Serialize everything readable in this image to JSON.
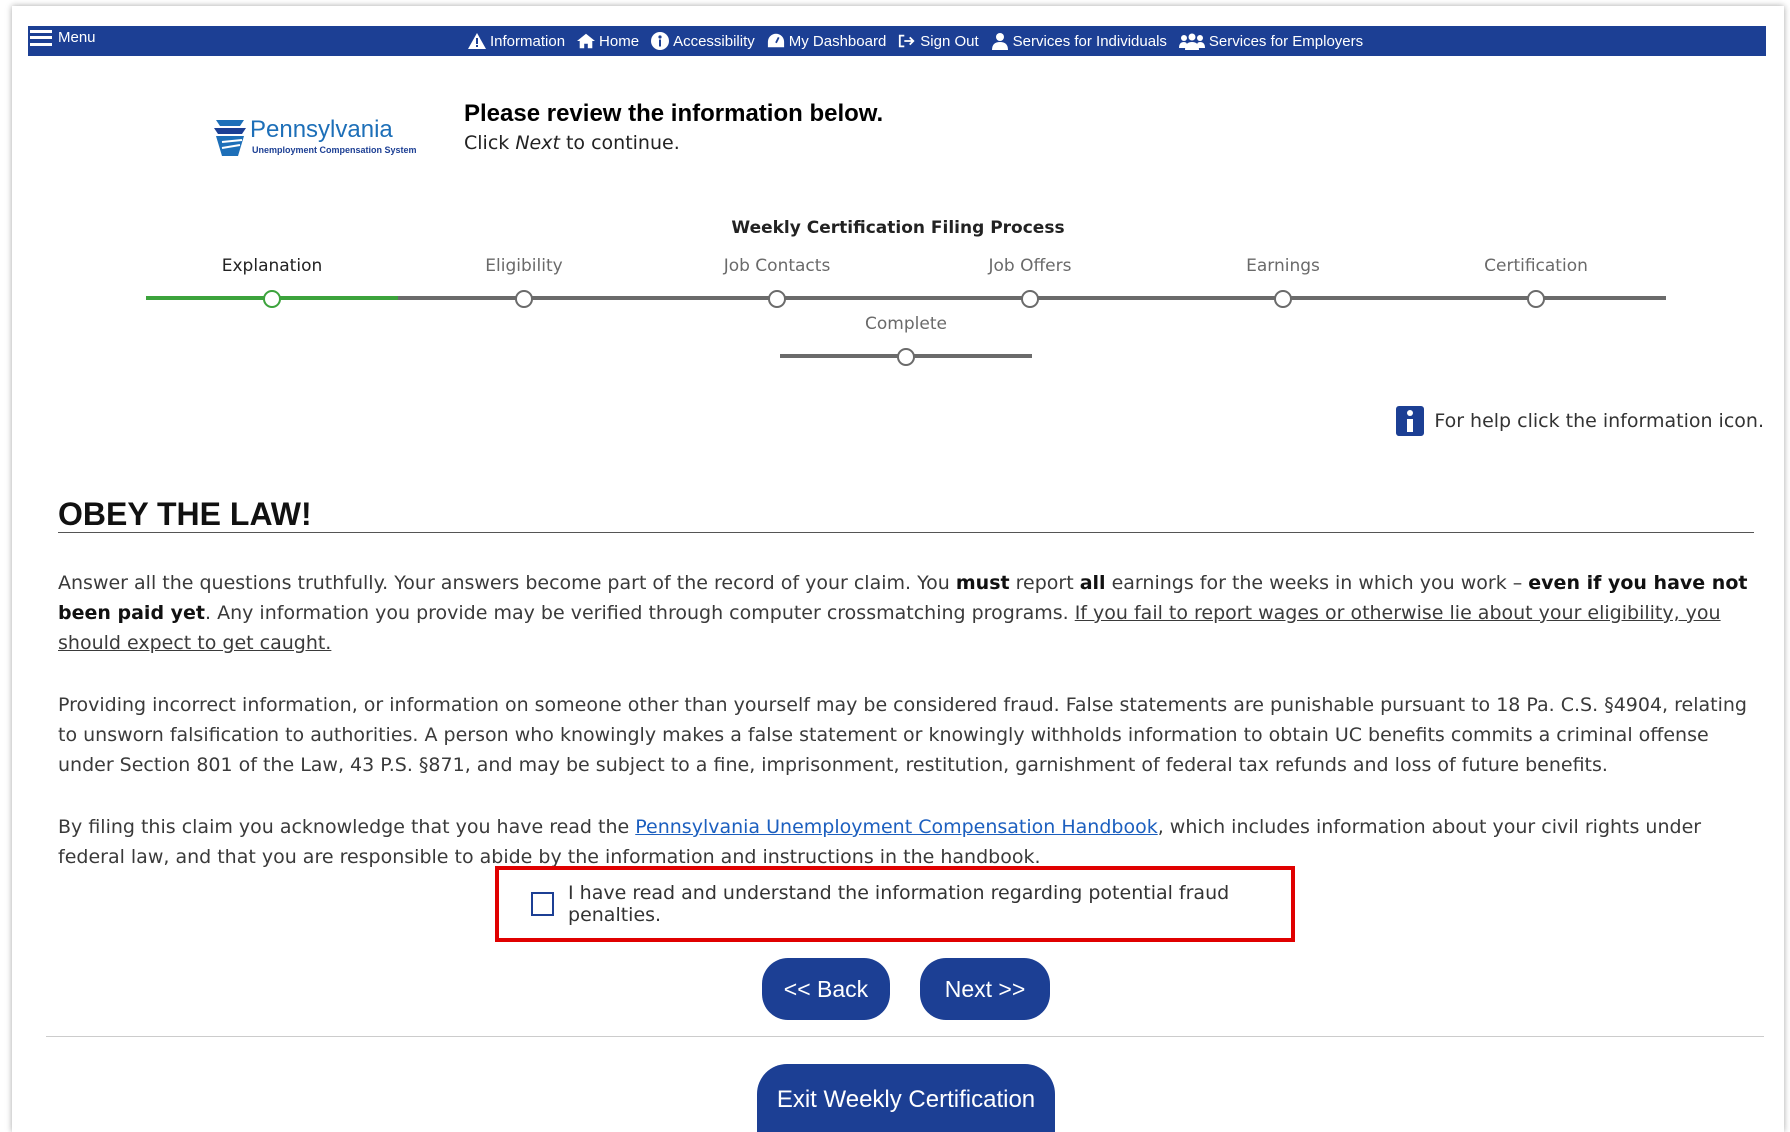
{
  "nav": {
    "menu_label": "Menu",
    "links": [
      {
        "label": "Information",
        "icon": "warning-icon"
      },
      {
        "label": "Home",
        "icon": "home-icon"
      },
      {
        "label": "Accessibility",
        "icon": "accessibility-icon"
      },
      {
        "label": "My Dashboard",
        "icon": "dashboard-icon"
      },
      {
        "label": "Sign Out",
        "icon": "sign-out-icon"
      },
      {
        "label": "Services for Individuals",
        "icon": "user-icon"
      },
      {
        "label": "Services for Employers",
        "icon": "users-icon"
      }
    ]
  },
  "logo": {
    "title": "Pennsylvania",
    "subtitle": "Unemployment Compensation System"
  },
  "header": {
    "title": "Please review the information below.",
    "sub_prefix": "Click ",
    "sub_emphasis": "Next",
    "sub_suffix": " to continue."
  },
  "process": {
    "title": "Weekly Certification Filing Process",
    "steps": [
      "Explanation",
      "Eligibility",
      "Job Contacts",
      "Job Offers",
      "Earnings",
      "Certification"
    ],
    "final_step": "Complete",
    "active_step": "Explanation"
  },
  "help": {
    "text": "For help click the information icon."
  },
  "content": {
    "heading": "OBEY THE LAW!",
    "p1": {
      "a": "Answer all the questions truthfully. Your answers become part of the record of your claim. You ",
      "b": "must",
      "c": " report ",
      "d": "all",
      "e": " earnings for the weeks in which you work – ",
      "f": "even if you have not been paid yet",
      "g": ". Any information you provide may be verified through computer crossmatching programs. ",
      "h": "If you fail to report wages or otherwise lie about your eligibility, you should expect to get caught."
    },
    "p2": "Providing incorrect information, or information on someone other than yourself may be considered fraud. False statements are punishable pursuant to 18 Pa. C.S. §4904, relating to unsworn falsification to authorities. A person who knowingly makes a false statement or knowingly withholds information to obtain UC benefits commits a criminal offense under Section 801 of the Law, 43 P.S. §871, and may be subject to a fine, imprisonment, restitution, garnishment of federal tax refunds and loss of future benefits.",
    "p3": {
      "a": "By filing this claim you acknowledge that you have read the ",
      "link": "Pennsylvania Unemployment Compensation Handbook",
      "b": ", which includes information about your civil rights under federal law, and that you are responsible to abide by the information and instructions in the handbook."
    },
    "acknowledge_label": "I have read and understand the information regarding potential fraud penalties.",
    "acknowledge_checked": false
  },
  "buttons": {
    "back": "<< Back",
    "next": "Next >>",
    "exit": "Exit Weekly Certification"
  },
  "colors": {
    "primary": "#1c3f94",
    "progress_done": "#3ca33c",
    "highlight": "#e00000"
  }
}
